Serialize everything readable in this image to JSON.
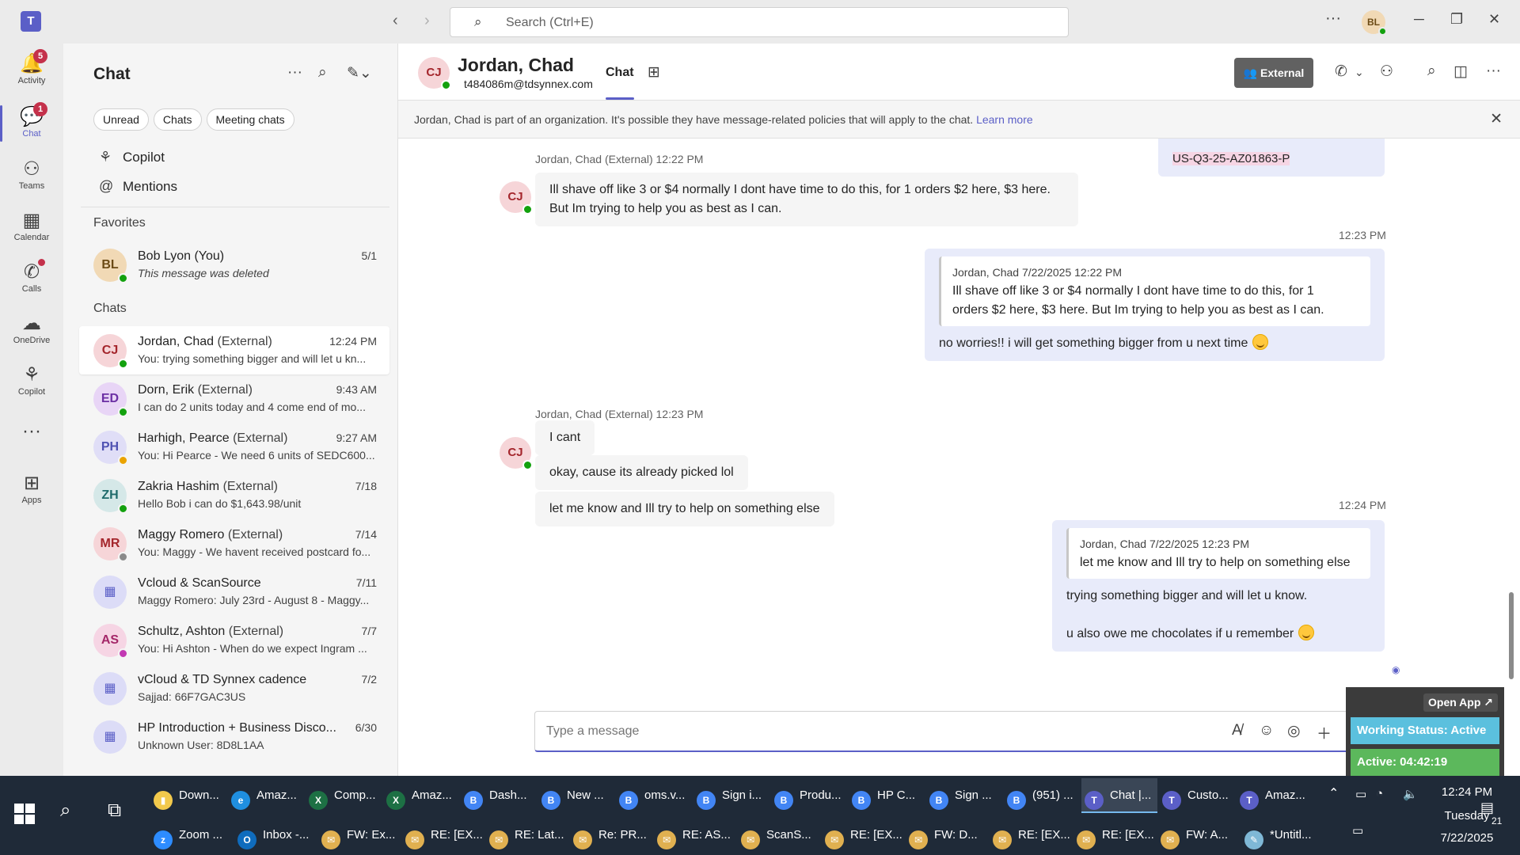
{
  "titlebar": {
    "logo_icon": "teams-logo-icon",
    "search_placeholder": "Search (Ctrl+E)",
    "avatar_initials": "BL"
  },
  "rail": {
    "items": [
      {
        "label": "Activity",
        "icon": "bell-icon",
        "badge": "5"
      },
      {
        "label": "Chat",
        "icon": "chat-icon",
        "badge": "1"
      },
      {
        "label": "Teams",
        "icon": "teams-icon"
      },
      {
        "label": "Calendar",
        "icon": "calendar-icon"
      },
      {
        "label": "Calls",
        "icon": "phone-icon"
      },
      {
        "label": "OneDrive",
        "icon": "cloud-icon"
      },
      {
        "label": "Copilot",
        "icon": "copilot-icon"
      },
      {
        "label": "Apps",
        "icon": "apps-icon"
      }
    ]
  },
  "chatlist": {
    "title": "Chat",
    "filters": [
      "Unread",
      "Chats",
      "Meeting chats"
    ],
    "links": [
      "Copilot",
      "Mentions"
    ],
    "favorites_heading": "Favorites",
    "chats_heading": "Chats",
    "favorites": [
      {
        "initials": "BL",
        "name": "Bob Lyon (You)",
        "ext": "",
        "time": "5/1",
        "preview": "This message was deleted",
        "italic": true,
        "avatar_bg": "#f1d9b5",
        "avatar_fg": "#6b4a15",
        "presence": "#13a10e"
      }
    ],
    "chats": [
      {
        "initials": "CJ",
        "name": "Jordan, Chad",
        "ext": "(External)",
        "time": "12:24 PM",
        "preview": "You: trying something bigger and will let u kn...",
        "avatar_bg": "#f6d5d8",
        "avatar_fg": "#a4262c",
        "presence": "#13a10e"
      },
      {
        "initials": "ED",
        "name": "Dorn, Erik",
        "ext": "(External)",
        "time": "9:43 AM",
        "preview": "I can do 2 units today and 4 come end of mo...",
        "avatar_bg": "#e8d5f6",
        "avatar_fg": "#6b2fa4",
        "presence": "#13a10e"
      },
      {
        "initials": "PH",
        "name": "Harhigh, Pearce",
        "ext": "(External)",
        "time": "9:27 AM",
        "preview": "You: Hi Pearce -  We need 6 units of SEDC600...",
        "avatar_bg": "#e0def7",
        "avatar_fg": "#4f52b2",
        "presence": "#eaa300"
      },
      {
        "initials": "ZH",
        "name": "Zakria Hashim",
        "ext": "(External)",
        "time": "7/18",
        "preview": "Hello Bob i can do $1,643.98/unit",
        "avatar_bg": "#d5e8e8",
        "avatar_fg": "#1f6b6b",
        "presence": "#13a10e"
      },
      {
        "initials": "MR",
        "name": "Maggy Romero",
        "ext": "(External)",
        "time": "7/14",
        "preview": "You: Maggy - We havent received postcard fo...",
        "avatar_bg": "#f6d5d8",
        "avatar_fg": "#a4262c",
        "presence": "#8a8a8a"
      },
      {
        "initials": "▦",
        "name": "Vcloud & ScanSource",
        "ext": "",
        "time": "7/11",
        "preview": "Maggy Romero: July 23rd - August 8 - Maggy...",
        "avatar_bg": "#dcdcf7",
        "avatar_fg": "#5b5fc7",
        "presence": ""
      },
      {
        "initials": "AS",
        "name": "Schultz, Ashton",
        "ext": "(External)",
        "time": "7/7",
        "preview": "You: Hi Ashton -  When do we expect Ingram ...",
        "avatar_bg": "#f6d5e4",
        "avatar_fg": "#a42668",
        "presence": "#c239b3"
      },
      {
        "initials": "▦",
        "name": "vCloud & TD Synnex cadence",
        "ext": "",
        "time": "7/2",
        "preview": "Sajjad: 66F7GAC3US",
        "avatar_bg": "#dcdcf7",
        "avatar_fg": "#5b5fc7",
        "presence": ""
      },
      {
        "initials": "▦",
        "name": "HP Introduction + Business Disco...",
        "ext": "",
        "time": "6/30",
        "preview": "Unknown User: 8D8L1AA",
        "avatar_bg": "#dcdcf7",
        "avatar_fg": "#5b5fc7",
        "presence": ""
      }
    ]
  },
  "header": {
    "initials": "CJ",
    "name": "Jordan, Chad",
    "email": "t484086m@tdsynnex.com",
    "tab": "Chat",
    "external_label": "External"
  },
  "banner": {
    "text": "Jordan, Chad is part of an organization. It's possible they have message-related policies that will apply to the chat.",
    "link": "Learn more"
  },
  "messages": {
    "top_partial": "US-Q3-25-AZ01863-P",
    "m1_meta": "Jordan, Chad (External)   12:22 PM",
    "m1_text_1": "Ill shave off like 3 or $4 normally I dont have time to do this, for 1 orders $2 here, $3 here.",
    "m1_text_2": "But Im trying to help you as best as I can.",
    "o1_time": "12:23 PM",
    "o1_quote_head": "Jordan, Chad   7/22/2025 12:22 PM",
    "o1_quote_1": "Ill shave off like 3 or $4 normally I dont have time to do this, for 1",
    "o1_quote_2": "orders $2 here, $3 here. But Im trying to help you as best as I can.",
    "o1_text": "no worries!! i will get something bigger from u next time",
    "m2_meta": "Jordan, Chad (External)   12:23 PM",
    "m2_a": "I cant",
    "m2_b": "okay, cause its already picked lol",
    "m2_c": "let me know and Ill try to help on something else",
    "o2_time": "12:24 PM",
    "o2_quote_head": "Jordan, Chad   7/22/2025 12:23 PM",
    "o2_quote_body": "let me know and Ill try to help on something else",
    "o2_text_1": "trying something bigger and will let u know.",
    "o2_text_2": "u also owe me chocolates if u remember"
  },
  "compose": {
    "placeholder": "Type a message"
  },
  "working_status": {
    "open_app": "Open App ↗",
    "status": "Working Status: Active",
    "active": "Active: 04:42:19"
  },
  "taskbar": {
    "row1": [
      {
        "label": "Down...",
        "color": "#f2c94c",
        "glyph": "▮"
      },
      {
        "label": "Amaz...",
        "color": "#1f8fe0",
        "glyph": "e"
      },
      {
        "label": "Comp...",
        "color": "#1d7044",
        "glyph": "X"
      },
      {
        "label": "Amaz...",
        "color": "#1d7044",
        "glyph": "X"
      },
      {
        "label": "Dash...",
        "color": "#4285f4",
        "glyph": "B"
      },
      {
        "label": "New ...",
        "color": "#4285f4",
        "glyph": "B"
      },
      {
        "label": "oms.v...",
        "color": "#4285f4",
        "glyph": "B"
      },
      {
        "label": "Sign i...",
        "color": "#4285f4",
        "glyph": "B"
      },
      {
        "label": "Produ...",
        "color": "#4285f4",
        "glyph": "B"
      },
      {
        "label": "HP C...",
        "color": "#4285f4",
        "glyph": "B"
      },
      {
        "label": "Sign ...",
        "color": "#4285f4",
        "glyph": "B"
      },
      {
        "label": "(951) ...",
        "color": "#4285f4",
        "glyph": "B"
      },
      {
        "label": "Chat |...",
        "color": "#5b5fc7",
        "glyph": "T"
      },
      {
        "label": "Custo...",
        "color": "#5b5fc7",
        "glyph": "T"
      },
      {
        "label": "Amaz...",
        "color": "#5b5fc7",
        "glyph": "T"
      }
    ],
    "row2": [
      {
        "label": "Zoom ...",
        "color": "#2d8cff",
        "glyph": "z"
      },
      {
        "label": "Inbox -...",
        "color": "#0f6cbd",
        "glyph": "O"
      },
      {
        "label": "FW: Ex...",
        "color": "#e0b050",
        "glyph": "✉"
      },
      {
        "label": "RE: [EX...",
        "color": "#e0b050",
        "glyph": "✉"
      },
      {
        "label": "RE: Lat...",
        "color": "#e0b050",
        "glyph": "✉"
      },
      {
        "label": "Re: PR...",
        "color": "#e0b050",
        "glyph": "✉"
      },
      {
        "label": "RE: AS...",
        "color": "#e0b050",
        "glyph": "✉"
      },
      {
        "label": "ScanS...",
        "color": "#e0b050",
        "glyph": "✉"
      },
      {
        "label": "RE: [EX...",
        "color": "#e0b050",
        "glyph": "✉"
      },
      {
        "label": "FW: D...",
        "color": "#e0b050",
        "glyph": "✉"
      },
      {
        "label": "RE: [EX...",
        "color": "#e0b050",
        "glyph": "✉"
      },
      {
        "label": "RE: [EX...",
        "color": "#e0b050",
        "glyph": "✉"
      },
      {
        "label": "FW: A...",
        "color": "#e0b050",
        "glyph": "✉"
      },
      {
        "label": "*Untitl...",
        "color": "#7fb8d6",
        "glyph": "✎"
      }
    ],
    "time": "12:24 PM",
    "day": "Tuesday",
    "date": "7/22/2025",
    "notif_count": "21"
  }
}
